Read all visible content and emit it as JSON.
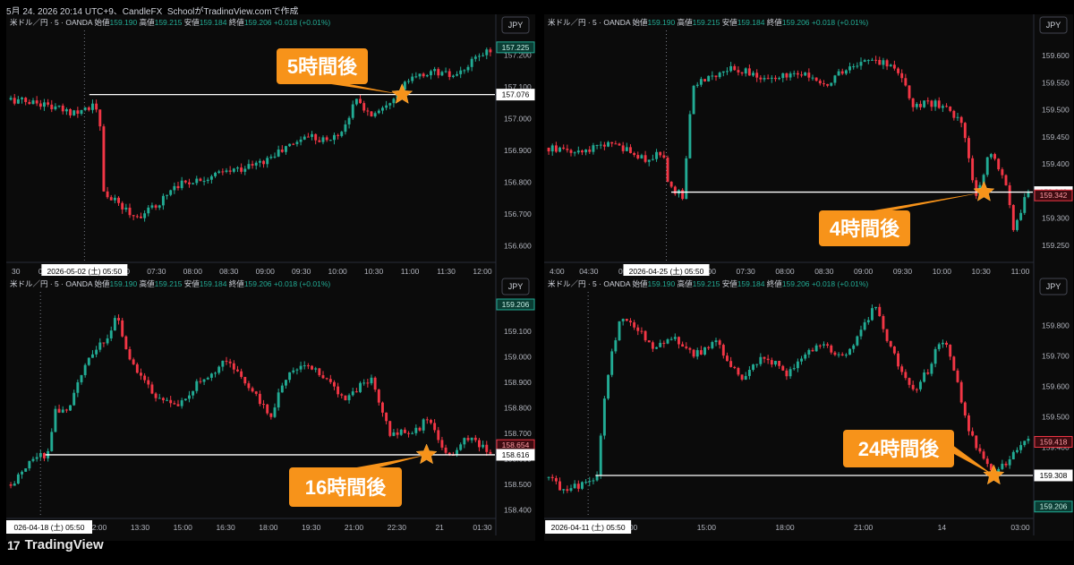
{
  "header": {
    "text": "5月 24, 2026 20:14 UTC+9、CandleFX_SchoolがTradingView.comで作成"
  },
  "brand": {
    "logo": "17",
    "name": "TradingView"
  },
  "colors": {
    "up": "#22ab94",
    "down": "#f23645",
    "bg": "#0b0b0b",
    "grid_text": "#b2b5be",
    "callout": "#f7931a"
  },
  "chart_data": [
    {
      "type": "candlestick",
      "symbol_line": "米ドル／円 · 5 · OANDA",
      "ohlc_labels": [
        "始値",
        "高値",
        "安値",
        "終値"
      ],
      "ohlc_values": [
        "159.190",
        "159.215",
        "159.184",
        "159.206"
      ],
      "change": "+0.018 (+0.01%)",
      "currency": "JPY",
      "y_ticks": [
        "157.200",
        "157.100",
        "157.000",
        "156.900",
        "156.800",
        "156.700",
        "156.600"
      ],
      "ylim": [
        156.55,
        157.25
      ],
      "x_ticks": [
        "30",
        "05:00",
        "06:00",
        "07:00",
        "07:30",
        "08:00",
        "08:30",
        "09:00",
        "09:30",
        "10:00",
        "10:30",
        "11:00",
        "11:30",
        "12:00"
      ],
      "date_label": "2026-05-02 (土)  05:50",
      "price_badges": [
        {
          "text": "157.225",
          "style": "up"
        },
        {
          "text": "157.076",
          "style": "white"
        }
      ],
      "h_line": 157.076,
      "callout": "5時間後",
      "anchors": [
        [
          0,
          157.06
        ],
        [
          0.06,
          157.05
        ],
        [
          0.12,
          157.02
        ],
        [
          0.17,
          157.04
        ],
        [
          0.185,
          157.02
        ],
        [
          0.19,
          156.77
        ],
        [
          0.26,
          156.69
        ],
        [
          0.3,
          156.72
        ],
        [
          0.34,
          156.79
        ],
        [
          0.42,
          156.82
        ],
        [
          0.52,
          156.86
        ],
        [
          0.62,
          156.95
        ],
        [
          0.66,
          156.93
        ],
        [
          0.69,
          156.96
        ],
        [
          0.72,
          157.06
        ],
        [
          0.75,
          157.01
        ],
        [
          0.79,
          157.06
        ],
        [
          0.83,
          157.12
        ],
        [
          0.88,
          157.15
        ],
        [
          0.93,
          157.13
        ],
        [
          0.97,
          157.19
        ],
        [
          1,
          157.22
        ]
      ],
      "sel_frac": 0.16,
      "line_start_frac": 0.17,
      "star_frac": 0.81
    },
    {
      "type": "candlestick",
      "symbol_line": "米ドル／円 · 5 · OANDA",
      "ohlc_labels": [
        "始値",
        "高値",
        "安値",
        "終値"
      ],
      "ohlc_values": [
        "159.190",
        "159.215",
        "159.184",
        "159.206"
      ],
      "change": "+0.018 (+0.01%)",
      "currency": "JPY",
      "y_ticks": [
        "159.600",
        "159.500",
        "159.400",
        "159.300",
        "159.250",
        "159.550",
        "159.450"
      ],
      "y_tick_values": [
        159.6,
        159.5,
        159.4,
        159.3,
        159.25,
        159.55,
        159.45
      ],
      "ylim": [
        159.22,
        159.63
      ],
      "x_ticks": [
        "4:00",
        "04:30",
        "05:00",
        "06:00",
        "07:00",
        "07:30",
        "08:00",
        "08:30",
        "09:00",
        "09:30",
        "10:00",
        "10:30",
        "11:00"
      ],
      "date_label": "2026-04-25 (土)  05:50",
      "price_badges": [
        {
          "text": "159.348",
          "style": "white"
        },
        {
          "text": "159.342",
          "style": "down"
        }
      ],
      "h_line": 159.348,
      "callout": "4時間後",
      "anchors": [
        [
          0,
          159.43
        ],
        [
          0.06,
          159.42
        ],
        [
          0.12,
          159.44
        ],
        [
          0.2,
          159.41
        ],
        [
          0.24,
          159.42
        ],
        [
          0.25,
          159.36
        ],
        [
          0.28,
          159.34
        ],
        [
          0.3,
          159.55
        ],
        [
          0.33,
          159.56
        ],
        [
          0.38,
          159.58
        ],
        [
          0.45,
          159.56
        ],
        [
          0.52,
          159.57
        ],
        [
          0.58,
          159.55
        ],
        [
          0.63,
          159.58
        ],
        [
          0.69,
          159.59
        ],
        [
          0.73,
          159.57
        ],
        [
          0.76,
          159.51
        ],
        [
          0.82,
          159.51
        ],
        [
          0.86,
          159.48
        ],
        [
          0.89,
          159.34
        ],
        [
          0.92,
          159.42
        ],
        [
          0.95,
          159.37
        ],
        [
          0.97,
          159.28
        ],
        [
          1,
          159.35
        ]
      ],
      "sel_frac": 0.25,
      "line_start_frac": 0.26,
      "star_frac": 0.9
    },
    {
      "type": "candlestick",
      "symbol_line": "米ドル／円 · 5 · OANDA",
      "ohlc_labels": [
        "始値",
        "高値",
        "安値",
        "終値"
      ],
      "ohlc_values": [
        "159.190",
        "159.215",
        "159.184",
        "159.206"
      ],
      "change": "+0.018 (+0.01%)",
      "currency": "JPY",
      "y_ticks": [
        "159.100",
        "159.000",
        "158.900",
        "158.800",
        "158.700",
        "158.600",
        "158.500",
        "158.400"
      ],
      "ylim": [
        158.37,
        159.22
      ],
      "x_ticks": [
        "09:00",
        "10:30",
        "12:00",
        "13:30",
        "15:00",
        "16:30",
        "18:00",
        "19:30",
        "21:00",
        "22:30",
        "21",
        "01:30"
      ],
      "date_label": "026-04-18 (土)  05:50",
      "price_badges": [
        {
          "text": "159.206",
          "style": "up"
        },
        {
          "text": "158.654",
          "style": "down"
        },
        {
          "text": "158.616",
          "style": "white"
        }
      ],
      "h_line": 158.616,
      "callout": "16時間後",
      "anchors": [
        [
          0,
          158.5
        ],
        [
          0.05,
          158.6
        ],
        [
          0.08,
          158.62
        ],
        [
          0.09,
          158.8
        ],
        [
          0.12,
          158.78
        ],
        [
          0.15,
          158.95
        ],
        [
          0.2,
          159.08
        ],
        [
          0.22,
          159.16
        ],
        [
          0.25,
          158.98
        ],
        [
          0.3,
          158.85
        ],
        [
          0.35,
          158.8
        ],
        [
          0.4,
          158.92
        ],
        [
          0.45,
          158.98
        ],
        [
          0.5,
          158.88
        ],
        [
          0.54,
          158.76
        ],
        [
          0.58,
          158.95
        ],
        [
          0.62,
          158.97
        ],
        [
          0.66,
          158.9
        ],
        [
          0.7,
          158.84
        ],
        [
          0.75,
          158.92
        ],
        [
          0.79,
          158.7
        ],
        [
          0.84,
          158.7
        ],
        [
          0.87,
          158.76
        ],
        [
          0.91,
          158.6
        ],
        [
          0.95,
          158.68
        ],
        [
          1,
          158.63
        ]
      ],
      "sel_frac": 0.07,
      "line_start_frac": 0.08,
      "star_frac": 0.86
    },
    {
      "type": "candlestick",
      "symbol_line": "米ドル／円 · 5 · OANDA",
      "ohlc_labels": [
        "始値",
        "高値",
        "安値",
        "終値"
      ],
      "ohlc_values": [
        "159.190",
        "159.215",
        "159.184",
        "159.206"
      ],
      "change": "+0.018 (+0.01%)",
      "currency": "JPY",
      "y_ticks": [
        "159.800",
        "159.700",
        "159.600",
        "159.500",
        "159.400"
      ],
      "ylim": [
        159.17,
        159.88
      ],
      "x_ticks": [
        "09:00",
        "12:00",
        "15:00",
        "18:00",
        "21:00",
        "14",
        "03:00"
      ],
      "date_label": "2026-04-11 (土)  05:50",
      "price_badges": [
        {
          "text": "159.418",
          "style": "down"
        },
        {
          "text": "159.308",
          "style": "white"
        },
        {
          "text": "159.206",
          "style": "up"
        }
      ],
      "h_line": 159.308,
      "callout": "24時間後",
      "anchors": [
        [
          0,
          159.3
        ],
        [
          0.03,
          159.26
        ],
        [
          0.08,
          159.28
        ],
        [
          0.1,
          159.29
        ],
        [
          0.12,
          159.62
        ],
        [
          0.15,
          159.84
        ],
        [
          0.18,
          159.8
        ],
        [
          0.22,
          159.73
        ],
        [
          0.26,
          159.76
        ],
        [
          0.3,
          159.7
        ],
        [
          0.35,
          159.74
        ],
        [
          0.4,
          159.62
        ],
        [
          0.45,
          159.7
        ],
        [
          0.5,
          159.64
        ],
        [
          0.56,
          159.74
        ],
        [
          0.62,
          159.7
        ],
        [
          0.68,
          159.86
        ],
        [
          0.72,
          159.7
        ],
        [
          0.76,
          159.58
        ],
        [
          0.79,
          159.65
        ],
        [
          0.82,
          159.76
        ],
        [
          0.84,
          159.7
        ],
        [
          0.87,
          159.48
        ],
        [
          0.9,
          159.38
        ],
        [
          0.93,
          159.32
        ],
        [
          0.96,
          159.36
        ],
        [
          1,
          159.43
        ]
      ],
      "sel_frac": 0.09,
      "line_start_frac": 0.105,
      "star_frac": 0.92
    }
  ]
}
